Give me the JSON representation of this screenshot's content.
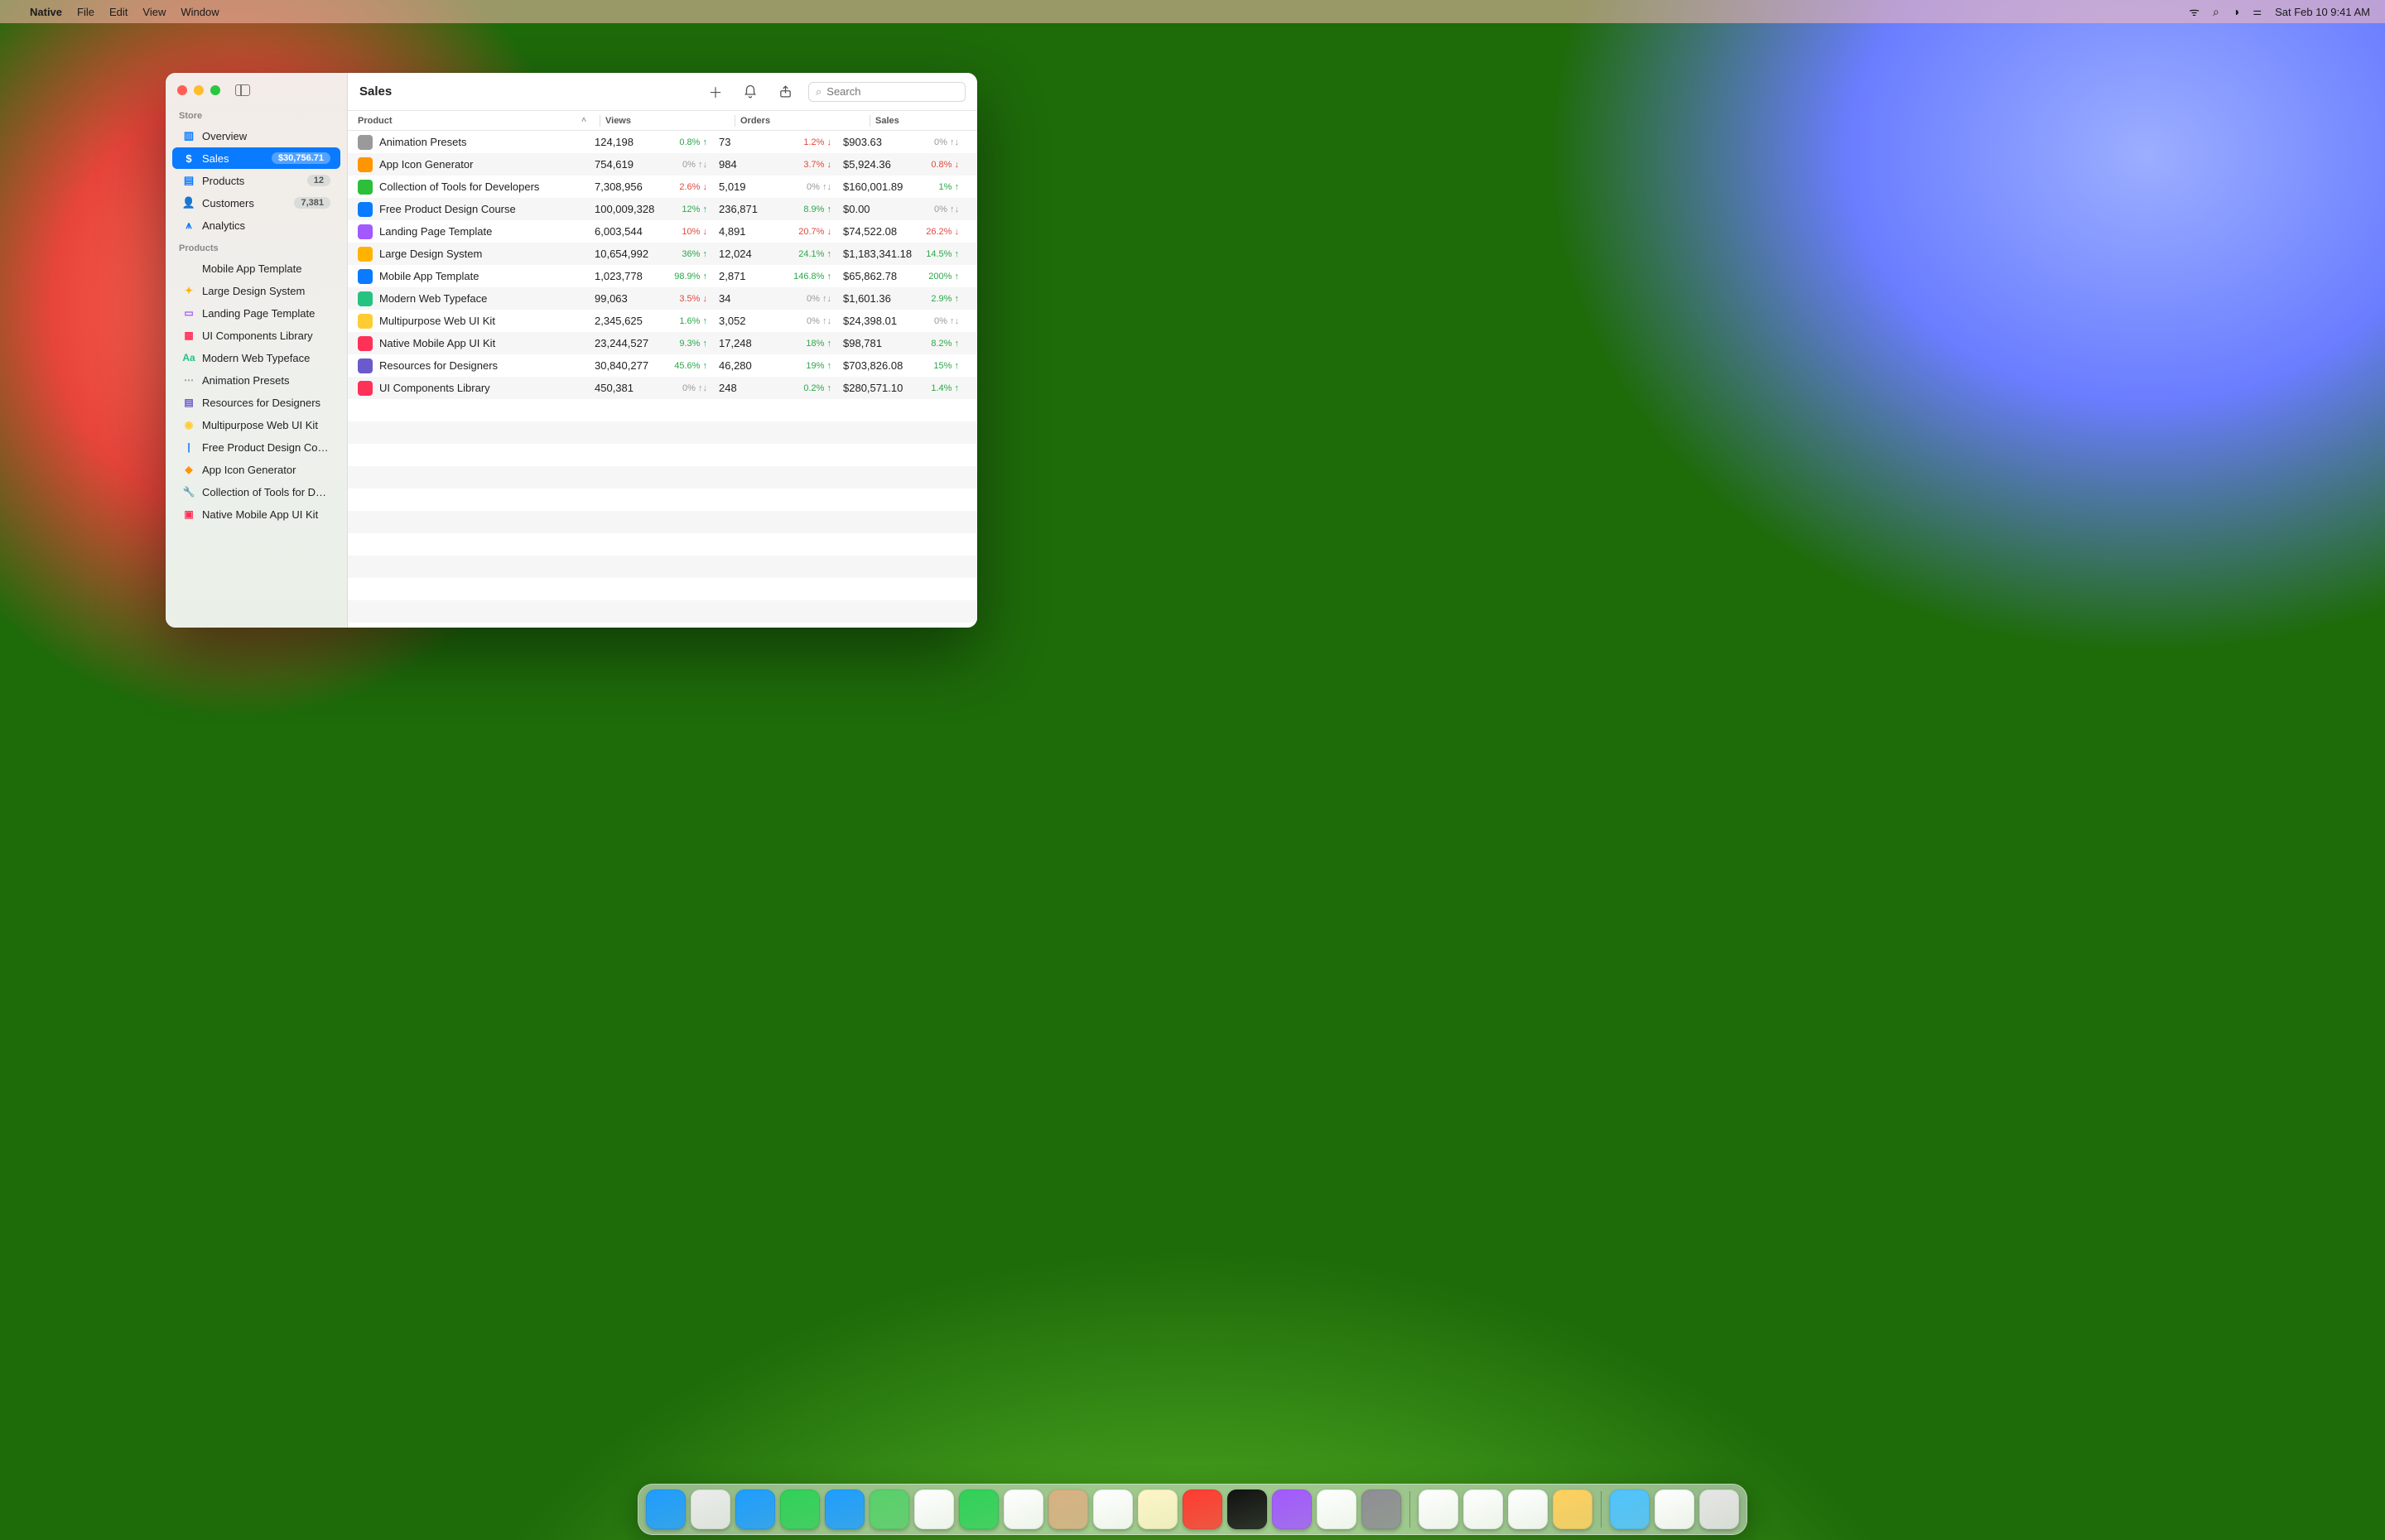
{
  "menubar": {
    "app_name": "Native",
    "items": [
      "File",
      "Edit",
      "View",
      "Window"
    ],
    "clock": "Sat Feb 10 9:41 AM"
  },
  "sidebar": {
    "section1_label": "Store",
    "store": [
      {
        "label": "Overview",
        "icon": "chart-bar-icon",
        "color": "#0a7aff"
      },
      {
        "label": "Sales",
        "icon": "dollar-icon",
        "color": "#0a7aff",
        "badge": "$30,756.71",
        "selected": true
      },
      {
        "label": "Products",
        "icon": "doc-icon",
        "color": "#0a7aff",
        "badge": "12"
      },
      {
        "label": "Customers",
        "icon": "person-icon",
        "color": "#0a7aff",
        "badge": "7,381"
      },
      {
        "label": "Analytics",
        "icon": "chart-line-icon",
        "color": "#0a7aff"
      }
    ],
    "section2_label": "Products",
    "products": [
      {
        "label": "Mobile App Template",
        "color": "#0a7aff",
        "glyph": "</>"
      },
      {
        "label": "Large Design System",
        "color": "#ffb300",
        "glyph": "✦"
      },
      {
        "label": "Landing Page Template",
        "color": "#a259ff",
        "glyph": "▭"
      },
      {
        "label": "UI Components Library",
        "color": "#ff3159",
        "glyph": "▦"
      },
      {
        "label": "Modern Web Typeface",
        "color": "#26c281",
        "glyph": "Aa"
      },
      {
        "label": "Animation Presets",
        "color": "#9a9a9a",
        "glyph": "⋯"
      },
      {
        "label": "Resources for Designers",
        "color": "#6a5acd",
        "glyph": "▤"
      },
      {
        "label": "Multipurpose Web UI Kit",
        "color": "#ffcc33",
        "glyph": "◉"
      },
      {
        "label": "Free Product Design Course",
        "color": "#0a7aff",
        "glyph": "|"
      },
      {
        "label": "App Icon Generator",
        "color": "#ff9500",
        "glyph": "◆"
      },
      {
        "label": "Collection of Tools for Dev…",
        "color": "#2bbf3a",
        "glyph": "🔧"
      },
      {
        "label": "Native Mobile App UI Kit",
        "color": "#ff3159",
        "glyph": "▣"
      }
    ]
  },
  "toolbar": {
    "title": "Sales",
    "search_placeholder": "Search"
  },
  "table": {
    "columns": {
      "product": "Product",
      "views": "Views",
      "orders": "Orders",
      "sales": "Sales"
    },
    "rows": [
      {
        "color": "#9a9a9a",
        "name": "Animation Presets",
        "views": "124,198",
        "views_pct": "0.8%",
        "views_dir": "up",
        "orders": "73",
        "orders_pct": "1.2%",
        "orders_dir": "down",
        "sales": "$903.63",
        "sales_pct": "0%",
        "sales_dir": "flat"
      },
      {
        "color": "#ff9500",
        "name": "App Icon Generator",
        "views": "754,619",
        "views_pct": "0%",
        "views_dir": "flat",
        "orders": "984",
        "orders_pct": "3.7%",
        "orders_dir": "down",
        "sales": "$5,924.36",
        "sales_pct": "0.8%",
        "sales_dir": "down"
      },
      {
        "color": "#2bbf3a",
        "name": "Collection of Tools for Developers",
        "views": "7,308,956",
        "views_pct": "2.6%",
        "views_dir": "down",
        "orders": "5,019",
        "orders_pct": "0%",
        "orders_dir": "flat",
        "sales": "$160,001.89",
        "sales_pct": "1%",
        "sales_dir": "up"
      },
      {
        "color": "#0a7aff",
        "name": "Free Product Design Course",
        "views": "100,009,328",
        "views_pct": "12%",
        "views_dir": "up",
        "orders": "236,871",
        "orders_pct": "8.9%",
        "orders_dir": "up",
        "sales": "$0.00",
        "sales_pct": "0%",
        "sales_dir": "flat"
      },
      {
        "color": "#a259ff",
        "name": "Landing Page Template",
        "views": "6,003,544",
        "views_pct": "10%",
        "views_dir": "down",
        "orders": "4,891",
        "orders_pct": "20.7%",
        "orders_dir": "down",
        "sales": "$74,522.08",
        "sales_pct": "26.2%",
        "sales_dir": "down"
      },
      {
        "color": "#ffb300",
        "name": "Large Design System",
        "views": "10,654,992",
        "views_pct": "36%",
        "views_dir": "up",
        "orders": "12,024",
        "orders_pct": "24.1%",
        "orders_dir": "up",
        "sales": "$1,183,341.18",
        "sales_pct": "14.5%",
        "sales_dir": "up"
      },
      {
        "color": "#0a7aff",
        "name": "Mobile App Template",
        "views": "1,023,778",
        "views_pct": "98.9%",
        "views_dir": "up",
        "orders": "2,871",
        "orders_pct": "146.8%",
        "orders_dir": "up",
        "sales": "$65,862.78",
        "sales_pct": "200%",
        "sales_dir": "up"
      },
      {
        "color": "#26c281",
        "name": "Modern Web Typeface",
        "views": "99,063",
        "views_pct": "3.5%",
        "views_dir": "down",
        "orders": "34",
        "orders_pct": "0%",
        "orders_dir": "flat",
        "sales": "$1,601.36",
        "sales_pct": "2.9%",
        "sales_dir": "up"
      },
      {
        "color": "#ffcc33",
        "name": "Multipurpose Web UI Kit",
        "views": "2,345,625",
        "views_pct": "1.6%",
        "views_dir": "up",
        "orders": "3,052",
        "orders_pct": "0%",
        "orders_dir": "flat",
        "sales": "$24,398.01",
        "sales_pct": "0%",
        "sales_dir": "flat"
      },
      {
        "color": "#ff3159",
        "name": "Native Mobile App UI Kit",
        "views": "23,244,527",
        "views_pct": "9.3%",
        "views_dir": "up",
        "orders": "17,248",
        "orders_pct": "18%",
        "orders_dir": "up",
        "sales": "$98,781",
        "sales_pct": "8.2%",
        "sales_dir": "up"
      },
      {
        "color": "#6a5acd",
        "name": "Resources for Designers",
        "views": "30,840,277",
        "views_pct": "45.6%",
        "views_dir": "up",
        "orders": "46,280",
        "orders_pct": "19%",
        "orders_dir": "up",
        "sales": "$703,826.08",
        "sales_pct": "15%",
        "sales_dir": "up"
      },
      {
        "color": "#ff3159",
        "name": "UI Components Library",
        "views": "450,381",
        "views_pct": "0%",
        "views_dir": "flat",
        "orders": "248",
        "orders_pct": "0.2%",
        "orders_dir": "up",
        "sales": "$280,571.10",
        "sales_pct": "1.4%",
        "sales_dir": "up"
      }
    ]
  },
  "dock": {
    "icons": [
      {
        "name": "finder",
        "color": "#1e9dff"
      },
      {
        "name": "launchpad",
        "color": "#ececec"
      },
      {
        "name": "safari",
        "color": "#1e9dff"
      },
      {
        "name": "messages",
        "color": "#30d158"
      },
      {
        "name": "mail",
        "color": "#1e9dff"
      },
      {
        "name": "maps",
        "color": "#58d06a"
      },
      {
        "name": "photos",
        "color": "#ffffff"
      },
      {
        "name": "facetime",
        "color": "#30d158"
      },
      {
        "name": "calendar",
        "color": "#ffffff"
      },
      {
        "name": "contacts",
        "color": "#d8b183"
      },
      {
        "name": "reminders",
        "color": "#ffffff"
      },
      {
        "name": "notes",
        "color": "#fff6c8"
      },
      {
        "name": "music",
        "color": "#ff3b30"
      },
      {
        "name": "tv",
        "color": "#111111"
      },
      {
        "name": "podcasts",
        "color": "#a259ff"
      },
      {
        "name": "news",
        "color": "#ffffff"
      },
      {
        "name": "settings",
        "color": "#8e8e93"
      }
    ],
    "icons_right": [
      {
        "name": "textedit",
        "color": "#ffffff"
      },
      {
        "name": "preview",
        "color": "#ffffff"
      },
      {
        "name": "keychain",
        "color": "#ffffff"
      },
      {
        "name": "app4",
        "color": "#ffd060"
      }
    ],
    "icons_far": [
      {
        "name": "downloads",
        "color": "#4fc3ff"
      },
      {
        "name": "pages-doc",
        "color": "#ffffff"
      },
      {
        "name": "trash",
        "color": "#e6e6e6"
      }
    ]
  }
}
